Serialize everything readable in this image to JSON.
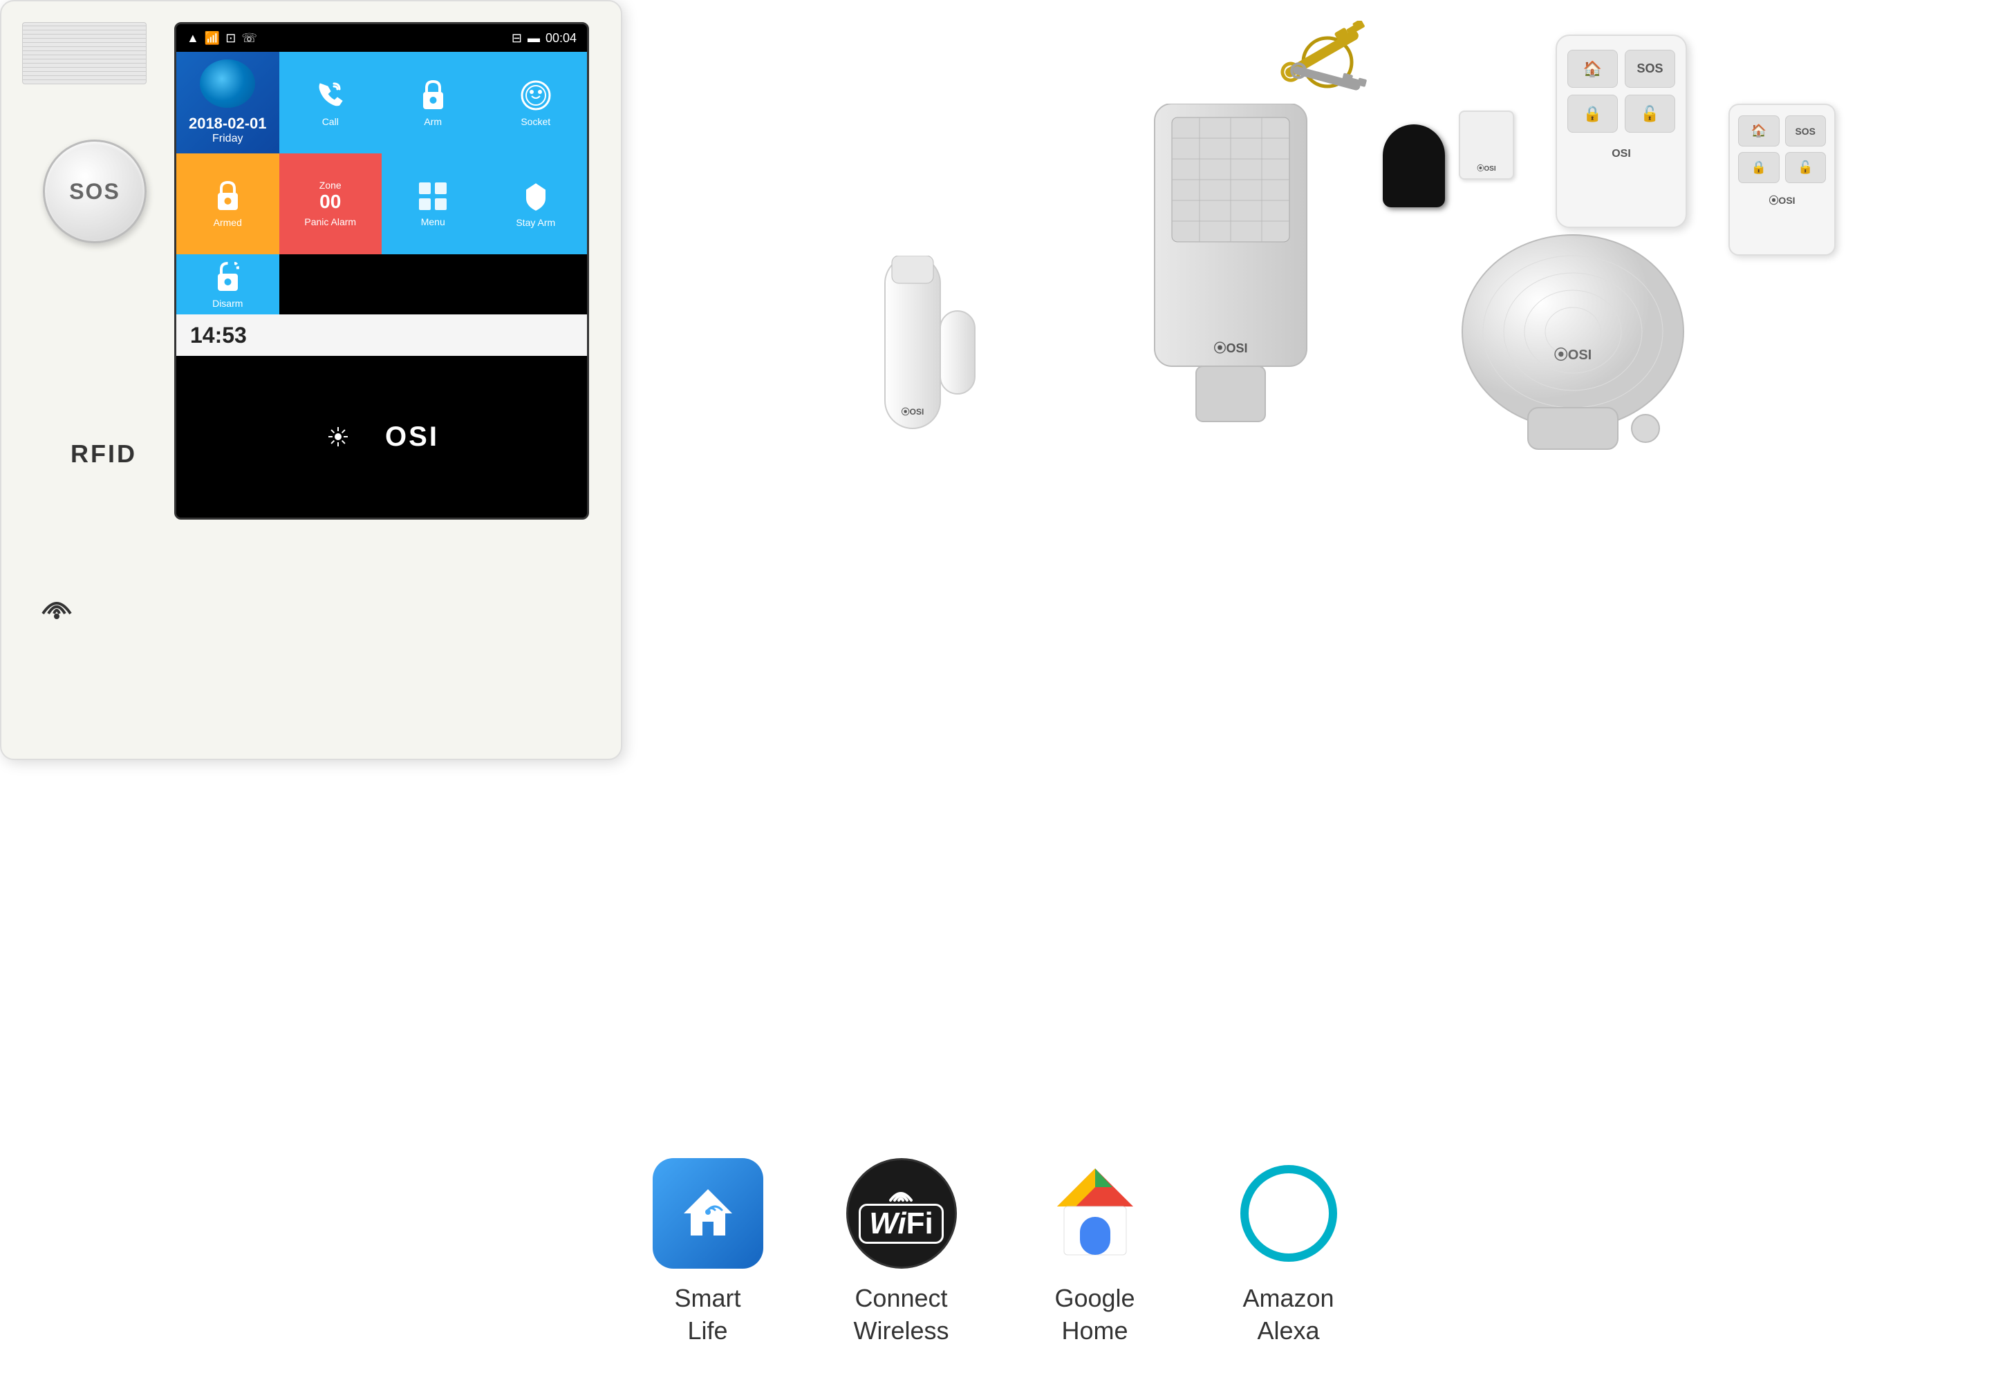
{
  "panel": {
    "brand": "OSI",
    "rfid_label": "RFID",
    "sos_label": "SOS",
    "screen": {
      "status_bar": {
        "signal": "▲.ul",
        "wifi": "WiFi",
        "phone": "☎",
        "key": "⌂",
        "battery": "🔋",
        "time": "00:04"
      },
      "date": "2018-02-01",
      "day": "Friday",
      "clock_time": "14:53",
      "tiles": [
        {
          "id": "call",
          "label": "Call",
          "icon": "📞"
        },
        {
          "id": "arm",
          "label": "Arm",
          "icon": "🔒"
        },
        {
          "id": "socket",
          "label": "Socket",
          "icon": "⚙"
        },
        {
          "id": "armed",
          "label": "Armed",
          "icon": "🔒"
        },
        {
          "id": "panic",
          "label": "Panic Alarm",
          "zone": "Zone",
          "zone_num": "00"
        },
        {
          "id": "menu",
          "label": "Menu",
          "icon": "▦"
        },
        {
          "id": "stay_arm",
          "label": "Stay Arm",
          "icon": "🏠"
        },
        {
          "id": "disarm",
          "label": "Disarm",
          "icon": "🔓"
        }
      ]
    }
  },
  "accessories": {
    "door_sensor_brand": "OSI",
    "pir_brand": "OSI",
    "siren_brand": "OSI",
    "remote_brand": "OSI"
  },
  "integrations": [
    {
      "id": "smart-life",
      "label_line1": "Smart",
      "label_line2": "Life"
    },
    {
      "id": "wifi",
      "label_line1": "Connect",
      "label_line2": "Wireless"
    },
    {
      "id": "google-home",
      "label_line1": "Google",
      "label_line2": "Home"
    },
    {
      "id": "amazon-alexa",
      "label_line1": "Amazon",
      "label_line2": "Alexa"
    }
  ],
  "overlay_labels": {
    "arm": "8 Arm",
    "cosi": "COSI"
  }
}
